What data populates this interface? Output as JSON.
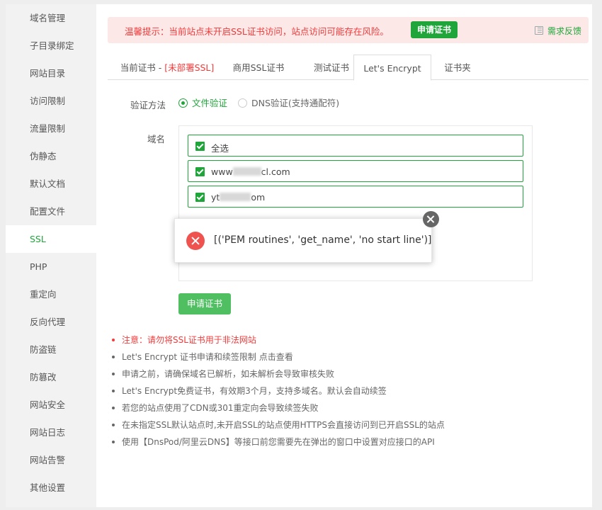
{
  "sidebar": {
    "items": [
      {
        "label": "域名管理"
      },
      {
        "label": "子目录绑定"
      },
      {
        "label": "网站目录"
      },
      {
        "label": "访问限制"
      },
      {
        "label": "流量限制"
      },
      {
        "label": "伪静态"
      },
      {
        "label": "默认文档"
      },
      {
        "label": "配置文件"
      },
      {
        "label": "SSL"
      },
      {
        "label": "PHP"
      },
      {
        "label": "重定向"
      },
      {
        "label": "反向代理"
      },
      {
        "label": "防盗链"
      },
      {
        "label": "防篡改"
      },
      {
        "label": "网站安全"
      },
      {
        "label": "网站日志"
      },
      {
        "label": "网站告警"
      },
      {
        "label": "其他设置"
      }
    ],
    "active": "SSL"
  },
  "alert": {
    "text": "温馨提示：当前站点未开启SSL证书访问，站点访问可能存在风险。",
    "button": "申请证书",
    "feedback": "需求反馈"
  },
  "tabs": {
    "current_prefix": "当前证书 - ",
    "current_status": "[未部署SSL]",
    "commercial": "商用SSL证书",
    "test": "测试证书",
    "letsencrypt": "Let's Encrypt",
    "folder": "证书夹"
  },
  "form": {
    "verify_label": "验证方法",
    "file_verify": "文件验证",
    "dns_verify": "DNS验证(支持通配符)",
    "domain_label": "域名",
    "select_all": "全选",
    "domain1_prefix": "www",
    "domain1_suffix": "cl.com",
    "domain2_prefix": "yt",
    "domain2_suffix": "om",
    "apply_button": "申请证书"
  },
  "notes": [
    "注意：请勿将SSL证书用于非法网站",
    "Let's Encrypt 证书申请和续签限制 点击查看",
    "申请之前，请确保域名已解析，如未解析会导致审核失败",
    "Let's Encrypt免费证书，有效期3个月，支持多域名。默认会自动续签",
    "若您的站点使用了CDN或301重定向会导致续签失败",
    "在未指定SSL默认站点时,未开启SSL的站点使用HTTPS会直接访问到已开启SSL的站点",
    "使用【DnsPod/阿里云DNS】等接口前您需要先在弹出的窗口中设置对应接口的API"
  ],
  "popup": {
    "message": "[('PEM routines', 'get_name', 'no start line')]"
  },
  "colors": {
    "accent": "#20a53a",
    "danger": "#ef3b3b"
  }
}
